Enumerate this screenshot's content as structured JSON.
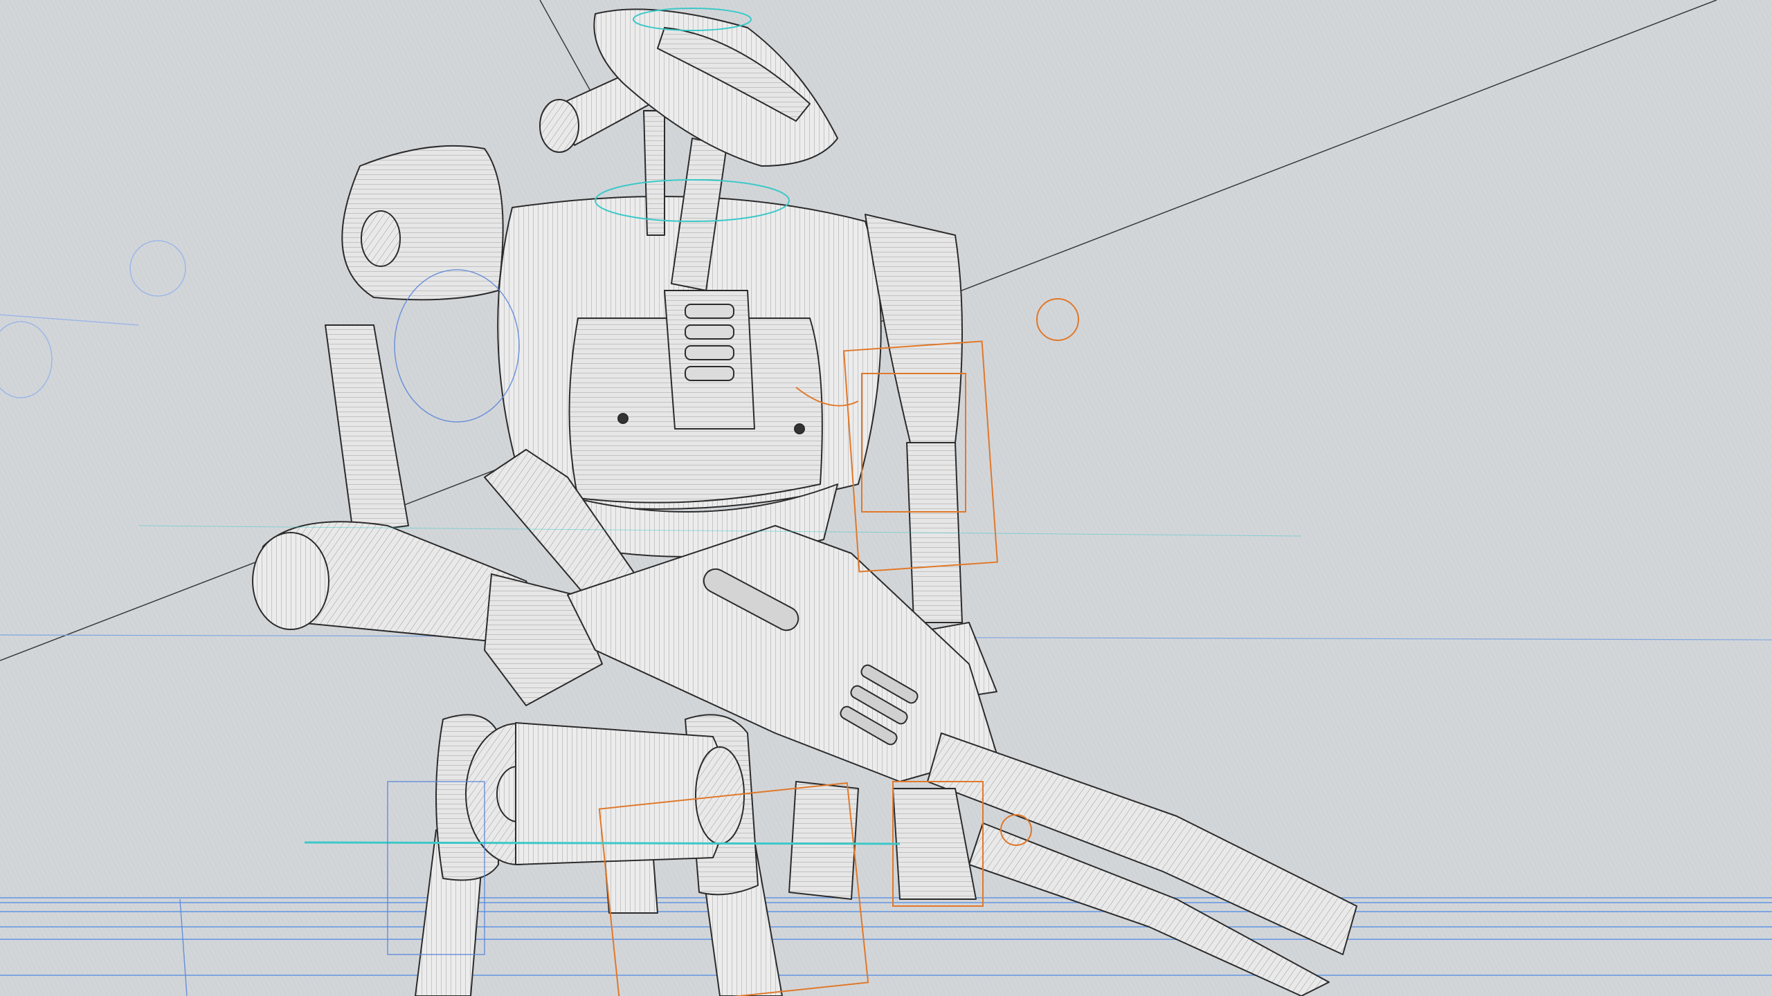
{
  "scene": {
    "description_visible_text": "",
    "colors": {
      "background": "#d3d6d9",
      "background_hatch": "#c6c9cd",
      "surface": "#eeeeee",
      "surface_shade": "#d8d8d8",
      "wire": "#2b2b2b",
      "selection_orange": "#e0782a",
      "gizmo_cyan": "#3cc8c8",
      "gizmo_blue": "#5a86d8",
      "floor_line": "#7da5e0"
    },
    "icons": [
      "robot-model",
      "rifle-model",
      "rig-controls"
    ]
  }
}
